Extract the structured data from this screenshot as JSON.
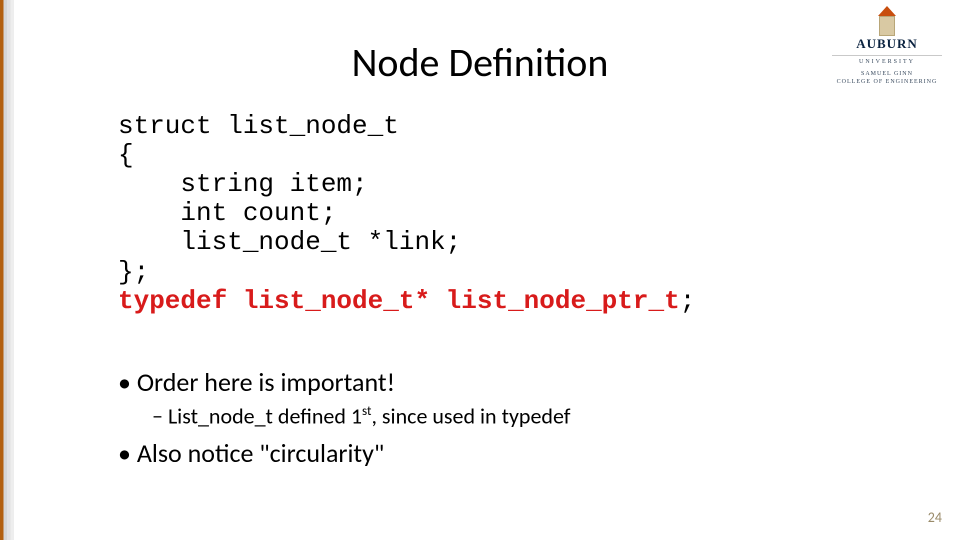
{
  "title": "Node Definition",
  "logo": {
    "main": "AUBURN",
    "sub": "UNIVERSITY",
    "college_l1": "SAMUEL GINN",
    "college_l2": "COLLEGE OF ENGINEERING"
  },
  "code": {
    "l1": "struct list_node_t",
    "l2": "{",
    "l3": "    string item;",
    "l4": "    int count;",
    "l5": "    list_node_t *link;",
    "l6": "};",
    "l7": "typedef list_node_t* list_node_ptr_t",
    "l7semi": ";"
  },
  "bullets": {
    "b1": "Order here is important!",
    "b2_pre": "List_node_t defined 1",
    "b2_sup": "st",
    "b2_post": ", since used in typedef",
    "b3": "Also notice \"circularity\""
  },
  "page": "24"
}
